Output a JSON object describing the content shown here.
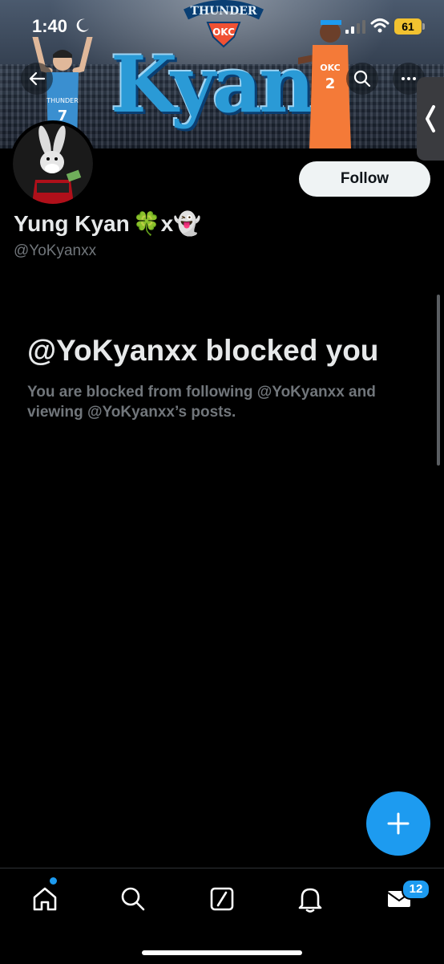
{
  "status_bar": {
    "time": "1:40",
    "battery": "61"
  },
  "banner": {
    "title": "Kyan",
    "team_logo_text": "THUNDER",
    "team_abbr": "OKC",
    "left_jersey_text": "THUNDER",
    "left_jersey_number": "7",
    "right_jersey_text": "OKC",
    "right_jersey_number": "2"
  },
  "profile": {
    "display_name": "Yung Kyan",
    "name_emojis": "🍀x👻",
    "handle": "@YoKyanxx",
    "follow_label": "Follow"
  },
  "blocked": {
    "title": "@YoKyanxx blocked you",
    "message": "You are blocked from following @YoKyanxx and viewing @YoKyanxx’s posts."
  },
  "tab_bar": {
    "messages_badge": "12"
  },
  "colors": {
    "accent": "#1d9bf0",
    "background": "#000000",
    "primary_text": "#e7e9ea",
    "secondary_text": "#71767b",
    "battery": "#f2c230"
  },
  "icons": [
    "back-arrow-icon",
    "search-icon",
    "more-icon",
    "chevron-left-icon",
    "plus-icon",
    "home-icon",
    "search-icon",
    "compose-icon",
    "bell-icon",
    "mail-icon"
  ]
}
